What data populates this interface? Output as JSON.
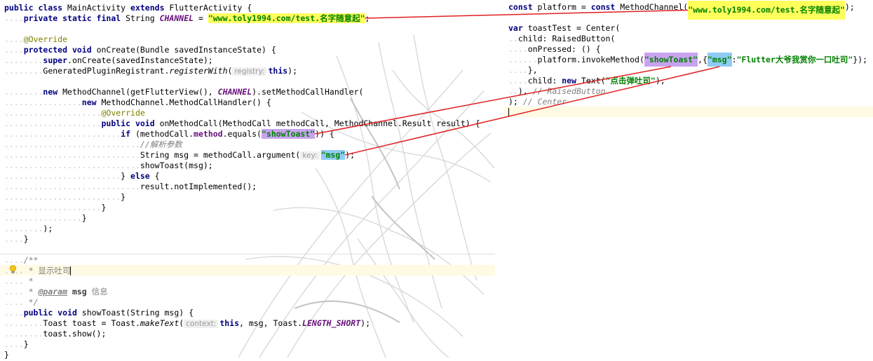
{
  "java": {
    "l1a": "public class",
    "l1b": " MainActivity ",
    "l1c": "extends",
    "l1d": " FlutterActivity {",
    "l2a": "private static final",
    "l2b": " String ",
    "l2c": "CHANNEL",
    "l2d": " = ",
    "l2e": "\"www.toly1994.com/test.名字随意起\"",
    "l2f": ";",
    "l3": "@Override",
    "l4a": "protected void",
    "l4b": " onCreate(Bundle savedInstanceState) {",
    "l5a": "super",
    "l5b": ".onCreate(savedInstanceState);",
    "l6a": "GeneratedPluginRegistrant.",
    "l6b": "registerWith",
    "l6c": "(",
    "l6hint": "registry:",
    "l6d": "this",
    "l6e": ");",
    "l7a": "new",
    "l7b": " MethodChannel(getFlutterView(), ",
    "l7c": "CHANNEL",
    "l7d": ").setMethodCallHandler(",
    "l8a": "new",
    "l8b": " MethodChannel.MethodCallHandler() {",
    "l9": "@Override",
    "l10a": "public void",
    "l10b": " onMethodCall(MethodCall methodCall, MethodChannel.Result result) {",
    "l11a": "if",
    "l11b": " (methodCall.",
    "l11c": "method",
    "l11d": ".equals(",
    "l11e": "\"showToast\"",
    "l11f": ")) {",
    "l12": "//解析参数",
    "l13a": "String msg = methodCall.argument(",
    "l13hint": "key:",
    "l13b": "\"msg\"",
    "l13c": ");",
    "l14": "showToast(msg);",
    "l15a": "} ",
    "l15b": "else",
    "l15c": " {",
    "l16": "result.notImplemented();",
    "l17": "}",
    "l18": "}",
    "l19": "}",
    "l20": ");",
    "l21": "}",
    "d1": "/**",
    "d2": " * 显示吐司",
    "d3": " *",
    "d4a": " * ",
    "d4b": "@param",
    "d4c": " msg",
    "d4d": " 信息",
    "d5": " */",
    "l22a": "public void",
    "l22b": " showToast(String msg) {",
    "l23a": "Toast toast = Toast.",
    "l23b": "makeText",
    "l23c": "(",
    "l23hint": "context:",
    "l23d": "this",
    "l23e": ", msg, Toast.",
    "l23f": "LENGTH_SHORT",
    "l23g": ");",
    "l24": "toast.show();",
    "l25": "}",
    "l26": "}"
  },
  "dart": {
    "r1a": "const",
    "r1b": " platform = ",
    "r1c": "const",
    "r1d": " MethodChannel(",
    "r1e": "\"www.toly1994.com/test.名字随意起\"",
    "r1f": ");",
    "r2a": "var",
    "r2b": " toastTest = Center(",
    "r3": "child: RaisedButton(",
    "r4": "onPressed: () {",
    "r5a": "platform.invokeMethod(",
    "r5b": "\"showToast\"",
    "r5c": ",{",
    "r5d": "\"msg\"",
    "r5e": ":",
    "r5f": "\"Flutter大爷我赏你一口吐司\"",
    "r5g": "});",
    "r6": "},",
    "r7a": "child: ",
    "r7b": "new",
    "r7c": " Text(",
    "r7d": "\"点击弹吐司\"",
    "r7e": "),",
    "r8a": "), ",
    "r8b": "// RaisedButton",
    "r9a": "); ",
    "r9b": "// Center"
  },
  "colors": {
    "keyword": "#000080",
    "string": "#008000",
    "constant": "#660e7a",
    "annotation": "#808000",
    "highlight_yellow": "#ffff5c",
    "highlight_purple": "#c9a3f0",
    "highlight_blue": "#8fcbf5",
    "arrow": "#e02020"
  }
}
